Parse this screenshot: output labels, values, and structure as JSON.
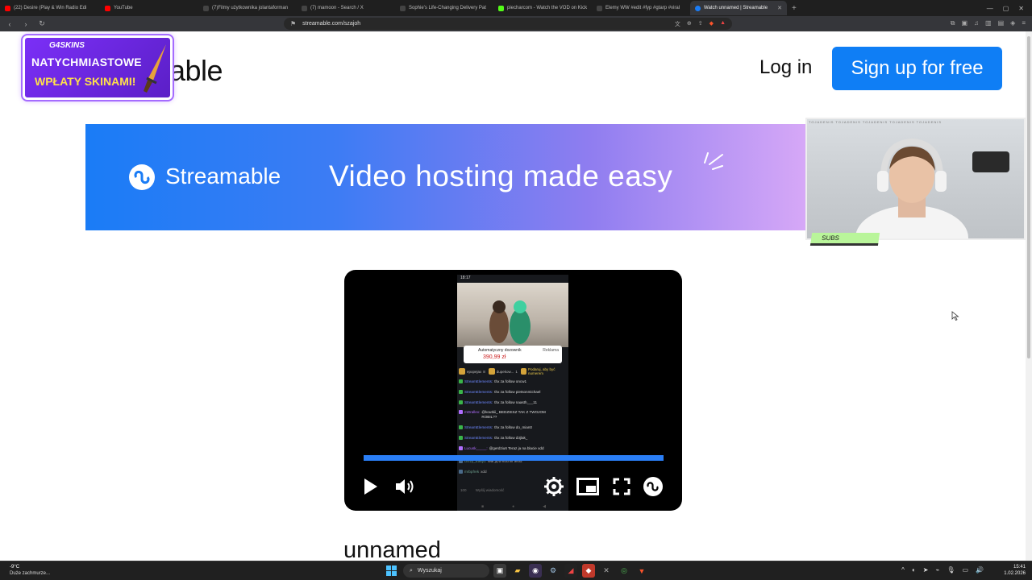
{
  "browser": {
    "tabs": [
      {
        "label": "(22) Desire (Play & Win Radio Edi",
        "color": "#ff0000",
        "active": false
      },
      {
        "label": "YouTube",
        "color": "#ff0000",
        "active": false
      },
      {
        "label": "(7)Filmy użytkownika jolantaforman",
        "color": "#111111",
        "active": false
      },
      {
        "label": "(7) mamoon - Search / X",
        "color": "#111111",
        "active": false
      },
      {
        "label": "Sophie's Life-Changing Delivery Pat",
        "color": "#111111",
        "active": false
      },
      {
        "label": "piecharcom - Watch the VOD on Kick",
        "color": "#53fc18",
        "active": false
      },
      {
        "label": "Elemy WW #edit #fyp #gtarp #viral",
        "color": "#111111",
        "active": false
      },
      {
        "label": "Watch unnamed | Streamable",
        "color": "#1a7cf6",
        "active": true
      }
    ],
    "url": "streamable.com/szajoh"
  },
  "page": {
    "logo_text": "able",
    "promo": {
      "brand": "G4SKINS",
      "line1": "NATYCHMIASTOWE",
      "line2": "WPŁATY SKINAMI!"
    },
    "login_label": "Log in",
    "signup_label": "Sign up for free",
    "banner": {
      "brand": "Streamable",
      "tagline": "Video hosting made easy"
    },
    "webcam": {
      "top_text": "TOJADENIS TOJADENIS TOJADENIS TOJADENIS TOJADENIS",
      "badge": "SUBS"
    },
    "video_title": "unnamed"
  },
  "player": {
    "progress_fraction": 1.0,
    "phone": {
      "status_time": "18:17",
      "ad_title": "Automatyczny dozownik",
      "ad_price": "390,99 zł",
      "ad_label": "Reklama",
      "gifts": [
        "epopejax",
        "dupekow...",
        "Podaruj, aby być numerem"
      ],
      "gift_counts": [
        "8",
        "1"
      ],
      "chat": [
        {
          "user": "StreamElements:",
          "text": "thx za follow oncw1",
          "purple": false
        },
        {
          "user": "StreamElements:",
          "text": "thx za follow pietsonmichael",
          "purple": false
        },
        {
          "user": "StreamElements:",
          "text": "thx za follow naasth___11",
          "purple": false
        },
        {
          "user": "mDrallex:",
          "text": "@koutkii_ BEDZIESZ TAK Z TWOJOM ROBIL??",
          "purple": true
        },
        {
          "user": "StreamElements:",
          "text": "thx za follow do_mian0",
          "purple": false
        },
        {
          "user": "StreamElements:",
          "text": "thx za follow d3jlak_",
          "purple": false
        },
        {
          "user": "Lucusk_____:",
          "text": "@gerdziu6 Teraz ja na blacie xdd",
          "purple": true
        },
        {
          "user": "Dizzy_Easy1",
          "text": "Wal ją w kuchni teraz",
          "purple": false
        },
        {
          "user": "mrbpfrek",
          "text": "xdd",
          "purple": false
        }
      ],
      "input_placeholder": "Wyślij wiadomość",
      "input_count": "100"
    }
  },
  "taskbar": {
    "weather_temp": "-9°C",
    "weather_desc": "Duże zachmurze...",
    "search_label": "Wyszukaj",
    "time": "15:41",
    "date": "1.02.2026"
  },
  "colors": {
    "signup": "#0f7ef5",
    "banner_start": "#1a7cf6",
    "banner_end": "#d6a8f7",
    "progress": "#2a7ef5"
  }
}
